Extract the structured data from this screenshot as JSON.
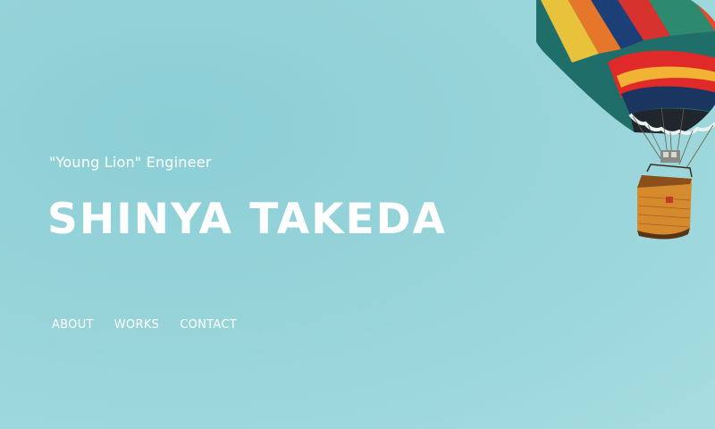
{
  "hero": {
    "tagline": "\"Young Lion\" Engineer",
    "name": "SHINYA TAKEDA"
  },
  "nav": {
    "items": [
      {
        "label": "ABOUT"
      },
      {
        "label": "WORKS"
      },
      {
        "label": "CONTACT"
      }
    ]
  },
  "colors": {
    "sky": "#9ed8dd",
    "text": "#ffffff"
  },
  "image": {
    "name": "hot-air-balloon"
  }
}
